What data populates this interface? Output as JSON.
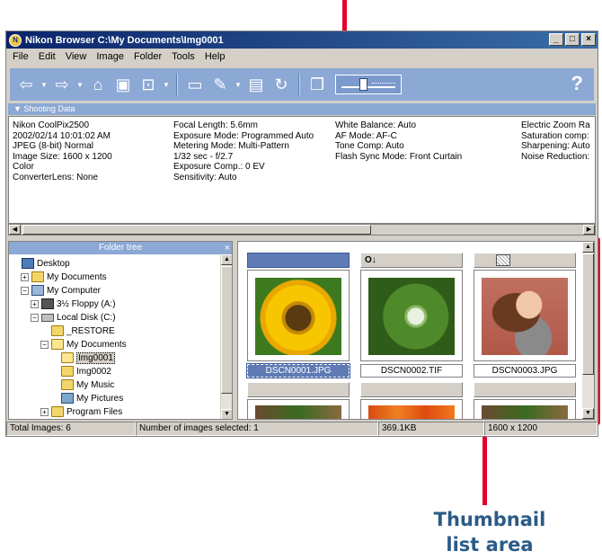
{
  "window": {
    "title": "Nikon Browser C:\\My Documents\\Img0001",
    "min": "_",
    "max": "□",
    "close": "×"
  },
  "menu": [
    "File",
    "Edit",
    "View",
    "Image",
    "Folder",
    "Tools",
    "Help"
  ],
  "toolbar": {
    "help": "?",
    "icons": [
      "back-icon",
      "forward-icon",
      "up-folder-icon",
      "new-folder-icon",
      "folder-options-icon",
      "open-folder-icon",
      "edit-icon",
      "print-icon",
      "rotate-icon",
      "copy-icon",
      "thumbnail-size-slider"
    ]
  },
  "shooting_data": {
    "header": "▼  Shooting Data",
    "col1": [
      "Nikon CoolPix2500",
      "2002/02/14 10:01:02 AM",
      "JPEG (8-bit) Normal",
      "Image Size:  1600 x 1200",
      "Color",
      "ConverterLens: None"
    ],
    "col2": [
      "Focal Length: 5.6mm",
      "Exposure Mode: Programmed Auto",
      "Metering Mode: Multi-Pattern",
      "1/32 sec - f/2.7",
      "Exposure Comp.: 0 EV",
      "Sensitivity: Auto"
    ],
    "col3": [
      "White Balance: Auto",
      "AF Mode: AF-C",
      "Tone Comp: Auto",
      "Flash Sync Mode: Front Curtain"
    ],
    "col4": [
      "Electric Zoom Ra",
      "Saturation comp:",
      "Sharpening: Auto",
      "Noise Reduction:"
    ]
  },
  "folder_tree": {
    "header": "Folder tree",
    "close": "×",
    "items": [
      {
        "label": "Desktop",
        "depth": 0,
        "pm": "",
        "icon": "desk"
      },
      {
        "label": "My Documents",
        "depth": 1,
        "pm": "+",
        "icon": "docs"
      },
      {
        "label": "My Computer",
        "depth": 1,
        "pm": "−",
        "icon": "pc"
      },
      {
        "label": "3½ Floppy (A:)",
        "depth": 2,
        "pm": "+",
        "icon": "floppy"
      },
      {
        "label": "Local Disk (C:)",
        "depth": 2,
        "pm": "−",
        "icon": "disk"
      },
      {
        "label": "_RESTORE",
        "depth": 3,
        "pm": "",
        "icon": "folder"
      },
      {
        "label": "My Documents",
        "depth": 3,
        "pm": "−",
        "icon": "folder open"
      },
      {
        "label": "Img0001",
        "depth": 4,
        "pm": "",
        "icon": "folder open",
        "selected": true
      },
      {
        "label": "Img0002",
        "depth": 4,
        "pm": "",
        "icon": "folder"
      },
      {
        "label": "My Music",
        "depth": 4,
        "pm": "",
        "icon": "folder"
      },
      {
        "label": "My Pictures",
        "depth": 4,
        "pm": "",
        "icon": "pics"
      },
      {
        "label": "Program Files",
        "depth": 3,
        "pm": "+",
        "icon": "folder"
      }
    ]
  },
  "thumbnails": [
    {
      "label": "DSCN0001.JPG",
      "selected": true,
      "photo": "sunflower",
      "badge": ""
    },
    {
      "label": "DSCN0002.TIF",
      "selected": false,
      "photo": "drop",
      "badge": "key"
    },
    {
      "label": "DSCN0003.JPG",
      "selected": false,
      "photo": "girl",
      "badge": "raw"
    },
    {
      "label": "",
      "selected": false,
      "photo": "earth",
      "badge": ""
    },
    {
      "label": "",
      "selected": false,
      "photo": "flowers",
      "badge": ""
    },
    {
      "label": "",
      "selected": false,
      "photo": "earth",
      "badge": ""
    }
  ],
  "status": {
    "total": "Total Images: 6",
    "selected": "Number of images selected: 1",
    "size": "369.1KB",
    "dims": "1600 x 1200"
  },
  "callouts": {
    "thumbnail_line1": "Thumbnail",
    "thumbnail_line2": "list area"
  },
  "colors": {
    "annotation_red": "#e4002b",
    "toolbar_blue": "#8ca8d4",
    "callout_text": "#2b5b86"
  }
}
